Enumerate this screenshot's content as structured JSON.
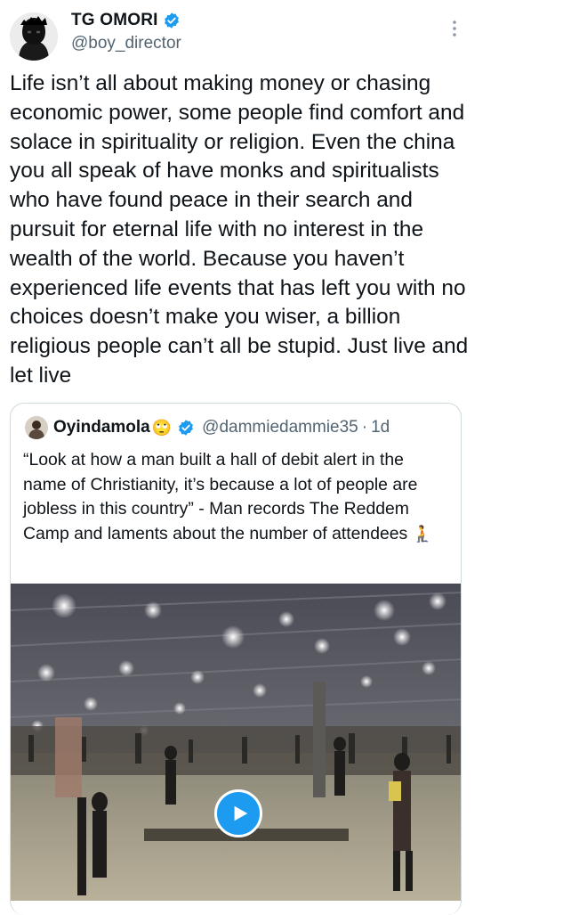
{
  "tweet": {
    "author_name": "TG OMORI",
    "author_handle": "@boy_director",
    "text": "Life isn’t all about making money or chasing economic power, some people find comfort and solace in spirituality or religion. Even the china you all speak of have monks and spiritualists who have found peace in their search and pursuit for eternal life with no interest in the wealth of the world. Because you haven’t experienced life events that has left you with no choices doesn’t make you wiser, a billion religious people can’t all be stupid. Just live and let live"
  },
  "quote": {
    "author_name": "Oyindamola",
    "name_emoji": "🙄",
    "author_handle": "@dammiedammie35",
    "separator": "·",
    "time": "1d",
    "text": "“Look at how a man built a hall of debit alert in the name of Christianity, it’s because a lot of people are jobless in this country” - Man records The Reddem Camp and laments about the number of attendees",
    "text_emoji": "🧎"
  },
  "icons": {
    "verified": "verified-badge-icon",
    "more": "more-options-icon",
    "play": "play-icon"
  },
  "colors": {
    "accent": "#1d9bf0",
    "secondary_text": "#536471",
    "border": "#cfd9de"
  }
}
